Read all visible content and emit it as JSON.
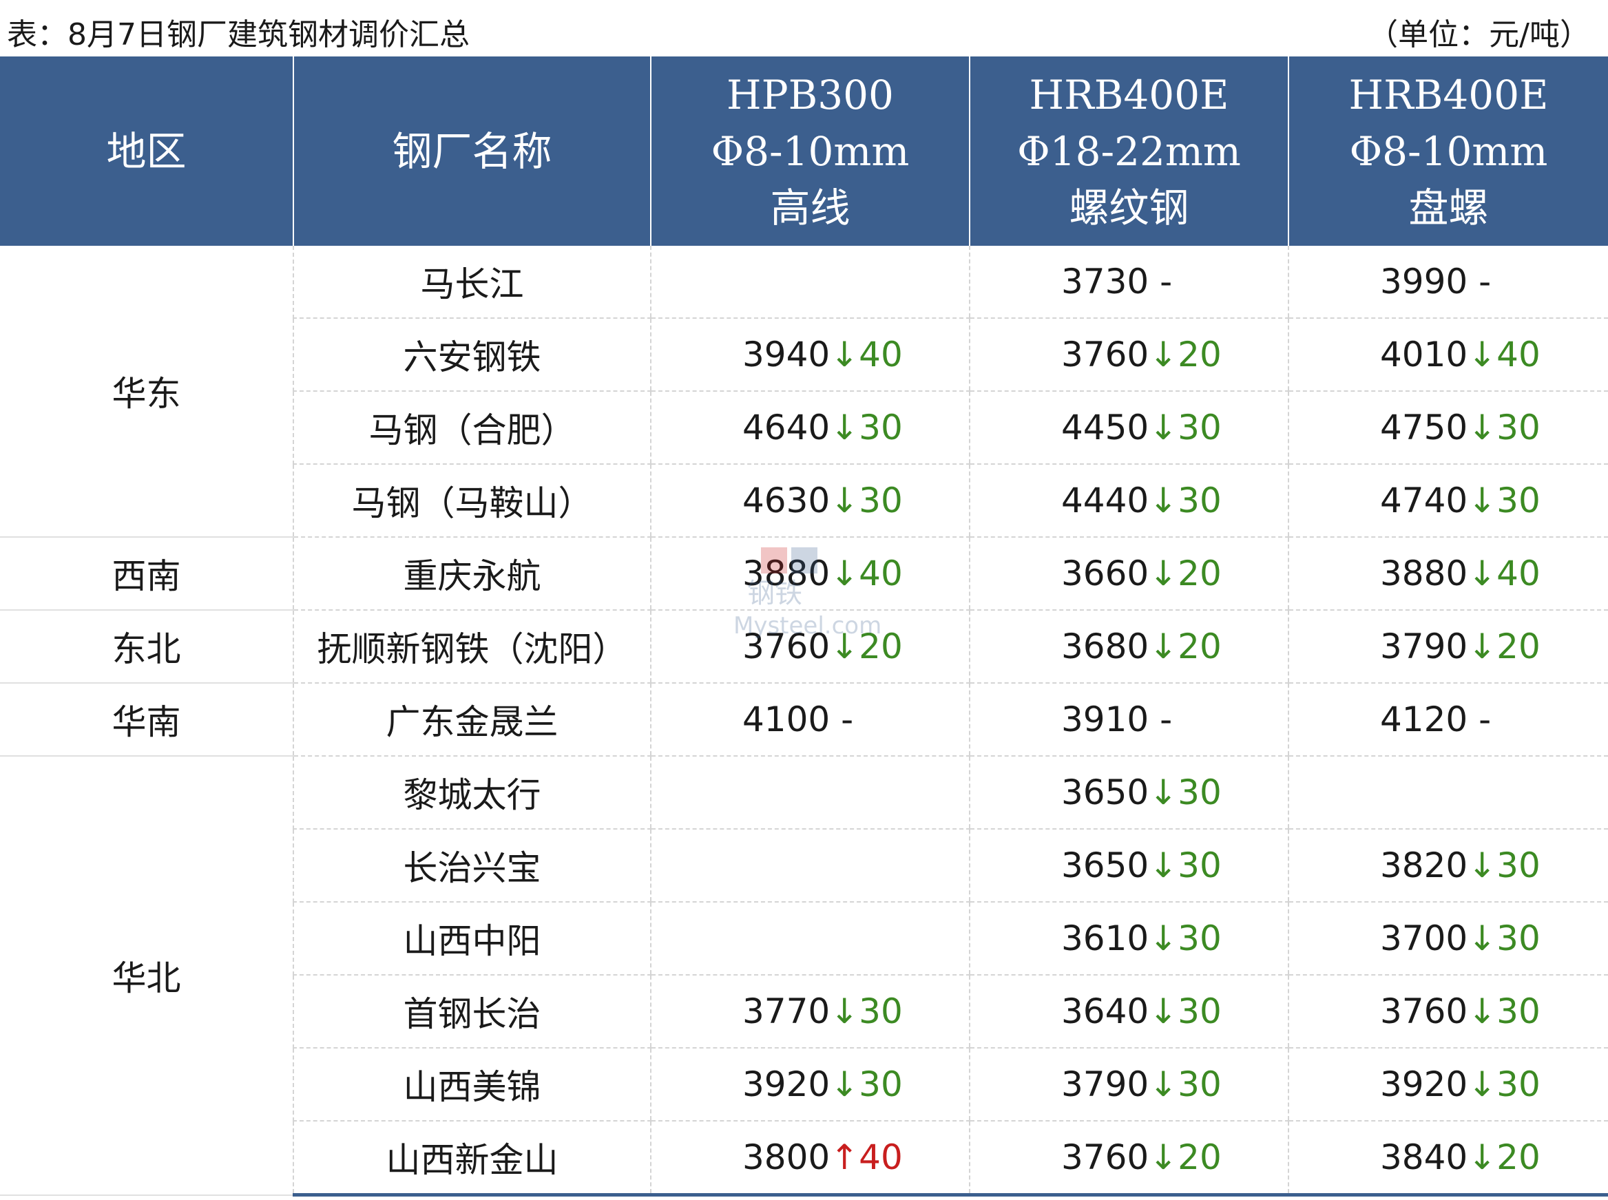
{
  "caption": {
    "title": "表：8月7日钢厂建筑钢材调价汇总",
    "unit": "（单位：元/吨）"
  },
  "headers": {
    "region": "地区",
    "mill": "钢厂名称",
    "col1": [
      "HPB300",
      "Φ8-10mm",
      "高线"
    ],
    "col2": [
      "HRB400E",
      "Φ18-22mm",
      "螺纹钢"
    ],
    "col3": [
      "HRB400E",
      "Φ8-10mm",
      "盘螺"
    ]
  },
  "regions": [
    "华东",
    "西南",
    "东北",
    "华南",
    "华北"
  ],
  "rows": [
    {
      "mill": "马长江",
      "cells": [
        null,
        {
          "price": "3730",
          "arrow": "",
          "change": "-",
          "dir": "flat"
        },
        {
          "price": "3990",
          "arrow": "",
          "change": "-",
          "dir": "flat"
        }
      ]
    },
    {
      "mill": "六安钢铁",
      "cells": [
        {
          "price": "3940",
          "arrow": "↓",
          "change": "40",
          "dir": "down"
        },
        {
          "price": "3760",
          "arrow": "↓",
          "change": "20",
          "dir": "down"
        },
        {
          "price": "4010",
          "arrow": "↓",
          "change": "40",
          "dir": "down"
        }
      ]
    },
    {
      "mill": "马钢（合肥）",
      "cells": [
        {
          "price": "4640",
          "arrow": "↓",
          "change": "30",
          "dir": "down"
        },
        {
          "price": "4450",
          "arrow": "↓",
          "change": "30",
          "dir": "down"
        },
        {
          "price": "4750",
          "arrow": "↓",
          "change": "30",
          "dir": "down"
        }
      ]
    },
    {
      "mill": "马钢（马鞍山）",
      "cells": [
        {
          "price": "4630",
          "arrow": "↓",
          "change": "30",
          "dir": "down"
        },
        {
          "price": "4440",
          "arrow": "↓",
          "change": "30",
          "dir": "down"
        },
        {
          "price": "4740",
          "arrow": "↓",
          "change": "30",
          "dir": "down"
        }
      ]
    },
    {
      "mill": "重庆永航",
      "cells": [
        {
          "price": "3880",
          "arrow": "↓",
          "change": "40",
          "dir": "down"
        },
        {
          "price": "3660",
          "arrow": "↓",
          "change": "20",
          "dir": "down"
        },
        {
          "price": "3880",
          "arrow": "↓",
          "change": "40",
          "dir": "down"
        }
      ]
    },
    {
      "mill": "抚顺新钢铁（沈阳）",
      "cells": [
        {
          "price": "3760",
          "arrow": "↓",
          "change": "20",
          "dir": "down"
        },
        {
          "price": "3680",
          "arrow": "↓",
          "change": "20",
          "dir": "down"
        },
        {
          "price": "3790",
          "arrow": "↓",
          "change": "20",
          "dir": "down"
        }
      ]
    },
    {
      "mill": "广东金晟兰",
      "cells": [
        {
          "price": "4100",
          "arrow": "",
          "change": "-",
          "dir": "flat"
        },
        {
          "price": "3910",
          "arrow": "",
          "change": "-",
          "dir": "flat"
        },
        {
          "price": "4120",
          "arrow": "",
          "change": "-",
          "dir": "flat"
        }
      ]
    },
    {
      "mill": "黎城太行",
      "cells": [
        null,
        {
          "price": "3650",
          "arrow": "↓",
          "change": "30",
          "dir": "down"
        },
        null
      ]
    },
    {
      "mill": "长治兴宝",
      "cells": [
        null,
        {
          "price": "3650",
          "arrow": "↓",
          "change": "30",
          "dir": "down"
        },
        {
          "price": "3820",
          "arrow": "↓",
          "change": "30",
          "dir": "down"
        }
      ]
    },
    {
      "mill": "山西中阳",
      "cells": [
        null,
        {
          "price": "3610",
          "arrow": "↓",
          "change": "30",
          "dir": "down"
        },
        {
          "price": "3700",
          "arrow": "↓",
          "change": "30",
          "dir": "down"
        }
      ]
    },
    {
      "mill": "首钢长治",
      "cells": [
        {
          "price": "3770",
          "arrow": "↓",
          "change": "30",
          "dir": "down"
        },
        {
          "price": "3640",
          "arrow": "↓",
          "change": "30",
          "dir": "down"
        },
        {
          "price": "3760",
          "arrow": "↓",
          "change": "30",
          "dir": "down"
        }
      ]
    },
    {
      "mill": "山西美锦",
      "cells": [
        {
          "price": "3920",
          "arrow": "↓",
          "change": "30",
          "dir": "down"
        },
        {
          "price": "3790",
          "arrow": "↓",
          "change": "30",
          "dir": "down"
        },
        {
          "price": "3920",
          "arrow": "↓",
          "change": "30",
          "dir": "down"
        }
      ]
    },
    {
      "mill": "山西新金山",
      "cells": [
        {
          "price": "3800",
          "arrow": "↑",
          "change": "40",
          "dir": "up"
        },
        {
          "price": "3760",
          "arrow": "↓",
          "change": "20",
          "dir": "down"
        },
        {
          "price": "3840",
          "arrow": "↓",
          "change": "20",
          "dir": "down"
        }
      ]
    }
  ],
  "watermark": {
    "line1": "钢铁",
    "line2": "Mysteel.com"
  },
  "colors": {
    "header_bg": "#3c5f8e",
    "down": "#3c8a23",
    "up": "#c81e1e"
  }
}
